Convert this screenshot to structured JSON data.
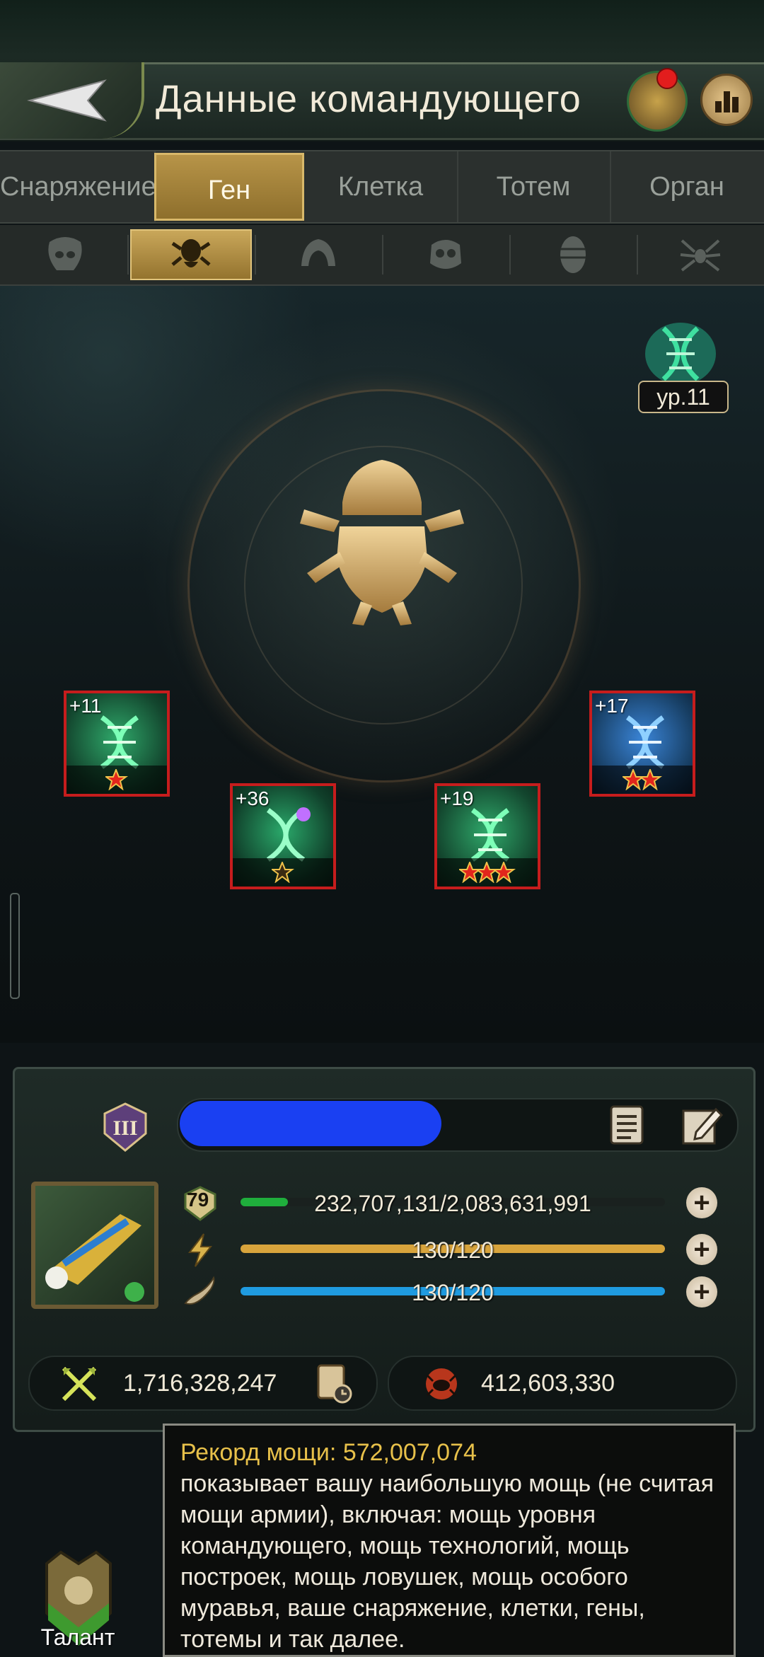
{
  "header": {
    "title": "Данные командующего",
    "back_icon": "back-arrow-icon",
    "ant_icon": "ant-avatar-icon",
    "rank_icon": "ranking-icon"
  },
  "tabs": [
    {
      "label": "Снаряжение",
      "active": false
    },
    {
      "label": "Ген",
      "active": true
    },
    {
      "label": "Клетка",
      "active": false
    },
    {
      "label": "Тотем",
      "active": false
    },
    {
      "label": "Орган",
      "active": false
    }
  ],
  "subtabs": [
    {
      "icon": "ant-head-icon",
      "active": false
    },
    {
      "icon": "beetle-icon",
      "active": true
    },
    {
      "icon": "mantis-icon",
      "active": false
    },
    {
      "icon": "skull-bug-icon",
      "active": false
    },
    {
      "icon": "larva-icon",
      "active": false
    },
    {
      "icon": "spider-icon",
      "active": false
    }
  ],
  "gene_level": {
    "label": "ур.11"
  },
  "gene_cards": [
    {
      "level": "+11",
      "stars": 1,
      "color": "green"
    },
    {
      "level": "+36",
      "stars": 1,
      "color": "white"
    },
    {
      "level": "+19",
      "stars": 3,
      "color": "green"
    },
    {
      "level": "+17",
      "stars": 2,
      "color": "blue"
    }
  ],
  "player": {
    "rank_badge": "III",
    "level": "79",
    "exp": "232,707,131/2,083,631,991",
    "exp_fraction": 0.112,
    "energy": "130/120",
    "energy_fraction": 1.0,
    "stamina": "130/120",
    "stamina_fraction": 1.0,
    "power": "1,716,328,247",
    "kills": "412,603,330"
  },
  "tooltip": {
    "title": "Рекорд мощи: 572,007,074",
    "body": "показывает вашу наибольшую мощь (не считая мощи армии), включая: мощь уровня командующего, мощь технологий, мощь построек, мощь ловушек, мощь особого муравья, ваше снаряжение, клетки, гены, тотемы и так далее."
  },
  "talent": {
    "label": "Талант"
  },
  "colors": {
    "accent_gold": "#c9a75a",
    "exp_bar": "#1fae3c",
    "energy_bar": "#d8a43c",
    "stamina_bar": "#1f9be0",
    "tooltip_title": "#e7c04a",
    "card_border": "#c61d1d"
  }
}
